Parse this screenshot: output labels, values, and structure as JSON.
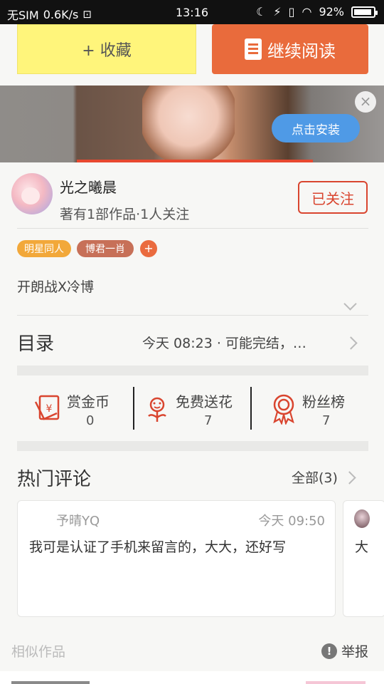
{
  "status_bar": {
    "carrier": "无SIM",
    "speed": "0.6K/s",
    "time": "13:16",
    "battery": "92%",
    "battery_level": 0.92
  },
  "actions": {
    "favorite_label": "+ 收藏",
    "continue_label": "继续阅读"
  },
  "ad": {
    "install_label": "点击安装",
    "close_label": "×"
  },
  "author": {
    "name": "光之曦晨",
    "stats": "著有1部作品·1人关注",
    "follow_label": "已关注"
  },
  "tags": [
    "明星同人",
    "博君一肖"
  ],
  "tag_add": "+",
  "description": "开朗战X冷博",
  "toc": {
    "title": "目录",
    "info": "今天 08:23 · 可能完结，…"
  },
  "stats": [
    {
      "label": "赏金币",
      "value": "0",
      "icon": "red-envelope-icon"
    },
    {
      "label": "免费送花",
      "value": "7",
      "icon": "flower-icon"
    },
    {
      "label": "粉丝榜",
      "value": "7",
      "icon": "medal-icon"
    }
  ],
  "hot_comments": {
    "title": "热门评论",
    "all_label": "全部(3)",
    "items": [
      {
        "user": "予晴YQ",
        "time": "今天 09:50",
        "text": "我可是认证了手机来留言的，大大，还好写"
      },
      {
        "text": "大"
      }
    ]
  },
  "similar_label": "相似作品",
  "report_label": "举报",
  "report_icon": "!",
  "colors": {
    "accent": "#e96b3c",
    "favorite_bg": "#fff57b",
    "follow": "#d9452f",
    "install": "#4f9ae6"
  }
}
